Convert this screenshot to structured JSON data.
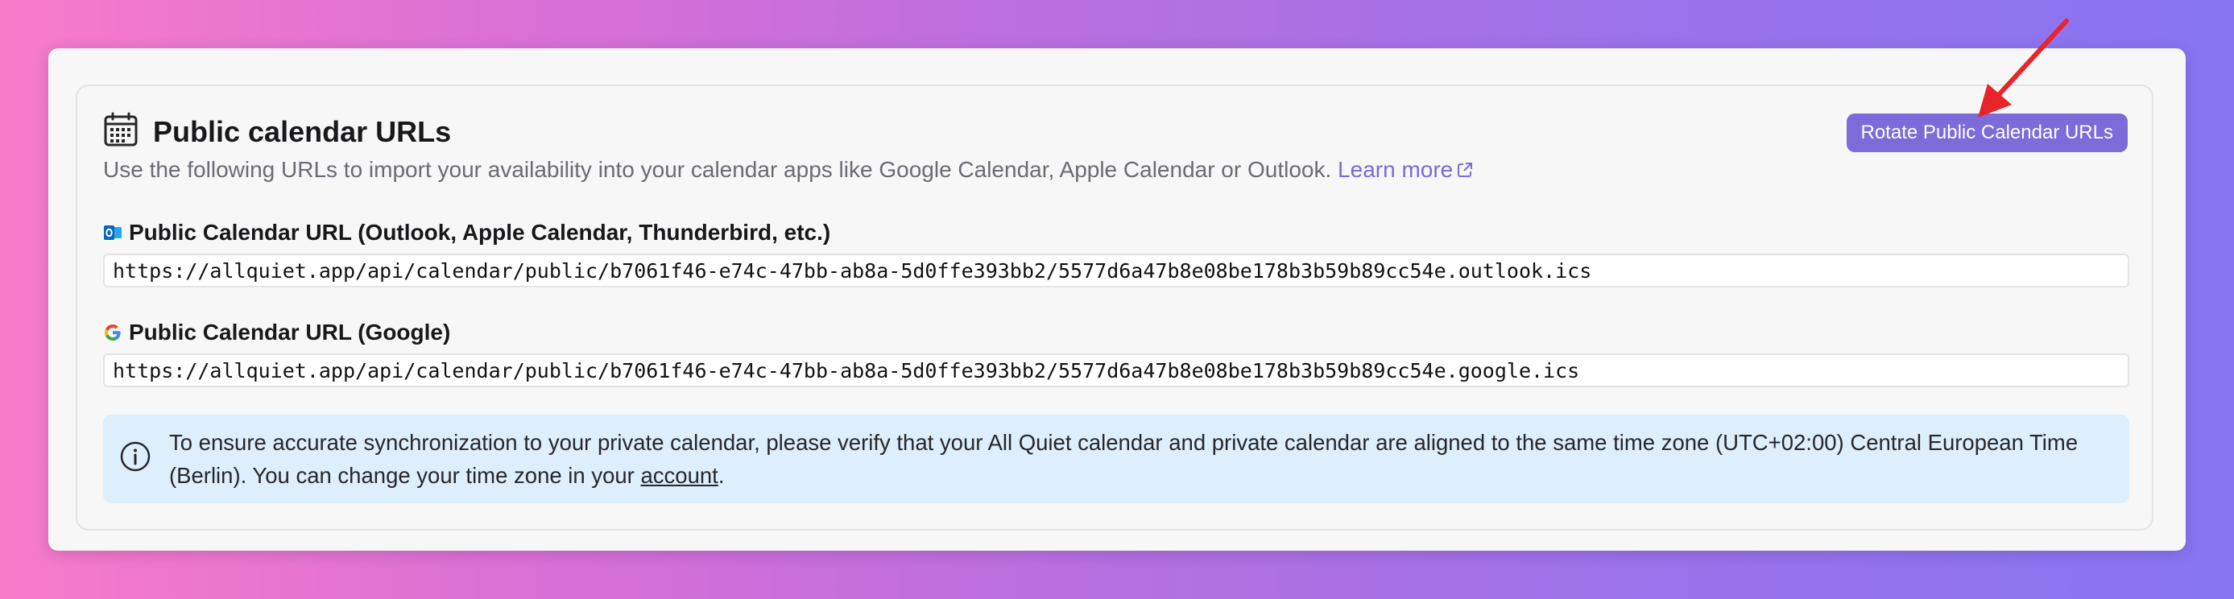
{
  "header": {
    "title": "Public calendar URLs",
    "subtitle": "Use the following URLs to import your availability into your calendar apps like Google Calendar, Apple Calendar or Outlook.",
    "learn_more": "Learn more",
    "icon": "calendar-icon"
  },
  "rotate_button": {
    "label": "Rotate Public Calendar URLs",
    "color": "#7c6bd9"
  },
  "fields": [
    {
      "label": "Public Calendar URL (Outlook, Apple Calendar, Thunderbird, etc.)",
      "icon": "outlook-icon",
      "value": "https://allquiet.app/api/calendar/public/b7061f46-e74c-47bb-ab8a-5d0ffe393bb2/5577d6a47b8e08be178b3b59b89cc54e.outlook.ics"
    },
    {
      "label": "Public Calendar URL (Google)",
      "icon": "google-icon",
      "value": "https://allquiet.app/api/calendar/public/b7061f46-e74c-47bb-ab8a-5d0ffe393bb2/5577d6a47b8e08be178b3b59b89cc54e.google.ics"
    }
  ],
  "info": {
    "icon": "info-icon",
    "text_before": "To ensure accurate synchronization to your private calendar, please verify that your All Quiet calendar and private calendar are aligned to the same time zone (UTC+02:00) Central European Time (Berlin). You can change your time zone in your ",
    "link": "account",
    "text_after": "."
  },
  "annotation": {
    "icon": "red-arrow-icon",
    "color": "#e8232a"
  },
  "colors": {
    "accent": "#7c6bd9",
    "info_bg": "#ddeffc"
  }
}
